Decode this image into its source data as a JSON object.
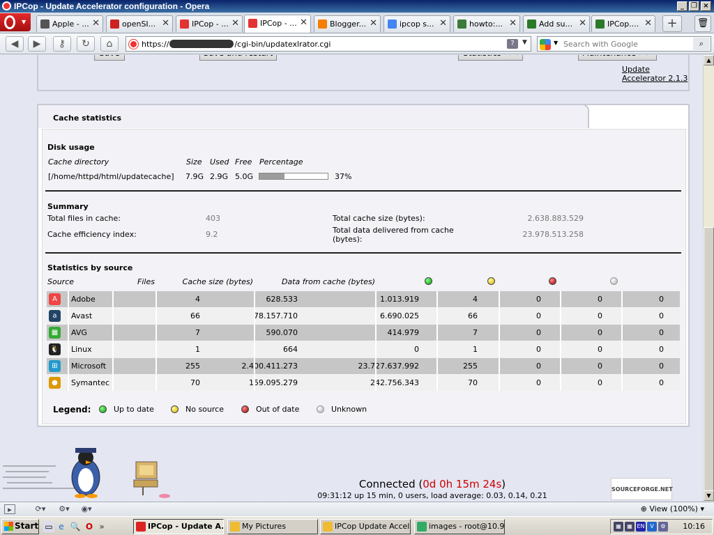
{
  "window": {
    "title": "IPCop - Update Accelerator configuration - Opera"
  },
  "tabs": [
    {
      "label": "Apple - ...",
      "icon": "apple-icon",
      "color": "#555555"
    },
    {
      "label": "openSI...",
      "icon": "apple-red-icon",
      "color": "#cc2222"
    },
    {
      "label": "IPCop - ...",
      "icon": "opera-icon",
      "color": "#e33333"
    },
    {
      "label": "IPCop - ...",
      "icon": "opera-icon",
      "color": "#e33333",
      "active": true
    },
    {
      "label": "Blogger...",
      "icon": "blogger-icon",
      "color": "#f57d00"
    },
    {
      "label": "ipcop s...",
      "icon": "google-icon",
      "color": "#4285f4"
    },
    {
      "label": "howto:...",
      "icon": "pencil-icon",
      "color": "#3a7a3a"
    },
    {
      "label": "Add su...",
      "icon": "doc-icon",
      "color": "#2a7a2a"
    },
    {
      "label": "IPCop....",
      "icon": "doc-icon",
      "color": "#2a7a2a"
    }
  ],
  "address": {
    "url_prefix": "https://",
    "url_suffix": "/cgi-bin/updatexlrator.cgi",
    "help": "?"
  },
  "search": {
    "placeholder": "Search with Google"
  },
  "buttons": {
    "save": "Save",
    "save_restart": "Save and restart",
    "statistics": "Statistics <<",
    "maintenance": "Maintenance >>"
  },
  "version_link": "Update Accelerator 2.1.3",
  "cache_stats": {
    "title": "Cache statistics",
    "disk_usage": {
      "heading": "Disk usage",
      "col_dir": "Cache directory",
      "col_size": "Size",
      "col_used": "Used",
      "col_free": "Free",
      "col_pct": "Percentage",
      "dir": "[/home/httpd/html/updatecache]",
      "size": "7.9G",
      "used": "2.9G",
      "free": "5.0G",
      "percentage": "37%",
      "percentage_value": 0.37
    },
    "summary": {
      "heading": "Summary",
      "files_label": "Total files in cache:",
      "files_value": "403",
      "efficiency_label": "Cache efficiency index:",
      "efficiency_value": "9.2",
      "size_label": "Total cache size (bytes):",
      "size_value": "2.638.883.529",
      "delivered_label": "Total data delivered from cache (bytes):",
      "delivered_value": "23.978.513.258"
    },
    "by_source": {
      "heading": "Statistics by source",
      "col_source": "Source",
      "col_files": "Files",
      "col_cache_size": "Cache size (bytes)",
      "col_data_from_cache": "Data from cache (bytes)",
      "rows": [
        {
          "source": "Adobe",
          "icon": "adobe-icon",
          "files": "4",
          "cache_size": "628.533",
          "data_from_cache": "1.013.919",
          "up_to_date": "4",
          "no_source": "0",
          "out_of_date": "0",
          "unknown": "0"
        },
        {
          "source": "Avast",
          "icon": "avast-icon",
          "files": "66",
          "cache_size": "78.157.710",
          "data_from_cache": "6.690.025",
          "up_to_date": "66",
          "no_source": "0",
          "out_of_date": "0",
          "unknown": "0"
        },
        {
          "source": "AVG",
          "icon": "avg-icon",
          "files": "7",
          "cache_size": "590.070",
          "data_from_cache": "414.979",
          "up_to_date": "7",
          "no_source": "0",
          "out_of_date": "0",
          "unknown": "0"
        },
        {
          "source": "Linux",
          "icon": "linux-icon",
          "files": "1",
          "cache_size": "664",
          "data_from_cache": "0",
          "up_to_date": "1",
          "no_source": "0",
          "out_of_date": "0",
          "unknown": "0"
        },
        {
          "source": "Microsoft",
          "icon": "microsoft-icon",
          "files": "255",
          "cache_size": "2.400.411.273",
          "data_from_cache": "23.727.637.992",
          "up_to_date": "255",
          "no_source": "0",
          "out_of_date": "0",
          "unknown": "0"
        },
        {
          "source": "Symantec",
          "icon": "symantec-icon",
          "files": "70",
          "cache_size": "159.095.279",
          "data_from_cache": "242.756.343",
          "up_to_date": "70",
          "no_source": "0",
          "out_of_date": "0",
          "unknown": "0"
        }
      ]
    },
    "legend": {
      "label": "Legend:",
      "up_to_date": "Up to date",
      "no_source": "No source",
      "out_of_date": "Out of date",
      "unknown": "Unknown"
    }
  },
  "status": {
    "connected_label": "Connected (",
    "connected_time": "0d 0h 15m 24s",
    "connected_close": ")",
    "uptime": "09:31:12 up 15 min, 0 users, load average: 0.03, 0.14, 0.21",
    "sourceforge": "SOURCEFORGE.NET"
  },
  "statusbar": {
    "zoom": "View (100%)"
  },
  "taskbar": {
    "start": "Start",
    "tasks": [
      {
        "label": "IPCop - Update A...",
        "active": true,
        "icon": "opera-icon"
      },
      {
        "label": "My Pictures",
        "active": false,
        "icon": "folder-search-icon"
      },
      {
        "label": "IPCop Update Accel...",
        "active": false,
        "icon": "folder-search-icon"
      },
      {
        "label": "images - root@10.9...",
        "active": false,
        "icon": "winscp-icon"
      }
    ],
    "tray_lang": "EN",
    "clock": "10:16"
  },
  "colors": {
    "row_dark": "#c6c6c6",
    "row_light": "#f0f0f0",
    "connected_time": "#cc0000"
  }
}
